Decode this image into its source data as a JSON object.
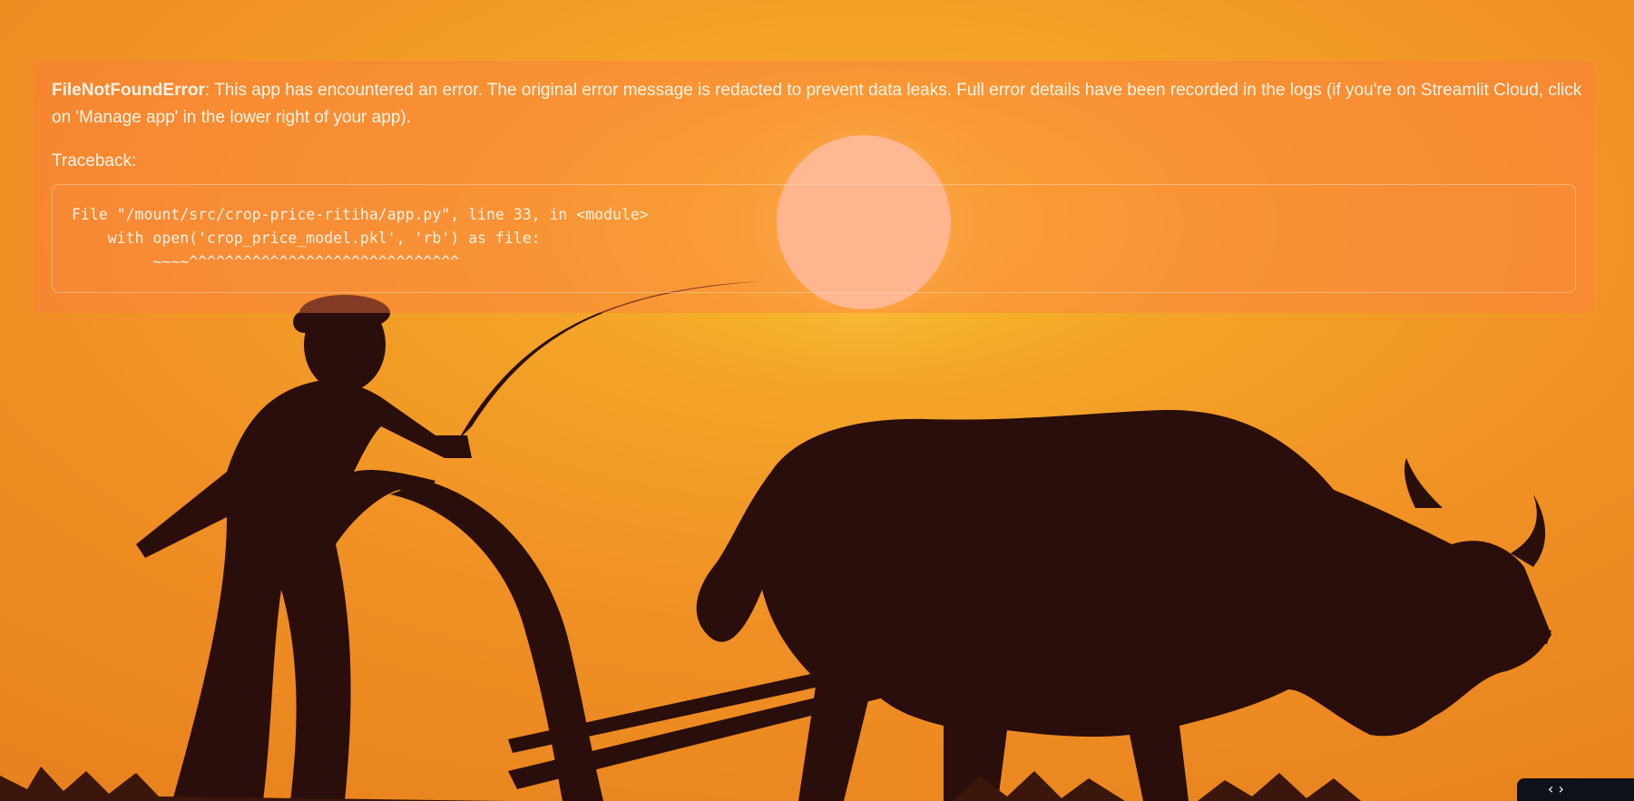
{
  "error": {
    "type": "FileNotFoundError",
    "message": ": This app has encountered an error. The original error message is redacted to prevent data leaks. Full error details have been recorded in the logs (if you're on Streamlit Cloud, click on 'Manage app' in the lower right of your app).",
    "traceback_label": "Traceback:",
    "traceback_lines": [
      "File \"/mount/src/crop-price-ritiha/app.py\", line 33, in <module>",
      "    with open('crop_price_model.pkl', 'rb') as file:",
      "         ~~~~^^^^^^^^^^^^^^^^^^^^^^^^^^^^^^"
    ]
  },
  "background": {
    "scene": "sunset-farmer-plowing-with-ox-silhouette",
    "sky_color": "#f39325",
    "sun_color": "#ffe6d2",
    "silhouette_color": "#2a0e0b"
  },
  "corner_widget": {
    "icon": "chevron-icon",
    "glyph": "‹ ›"
  }
}
